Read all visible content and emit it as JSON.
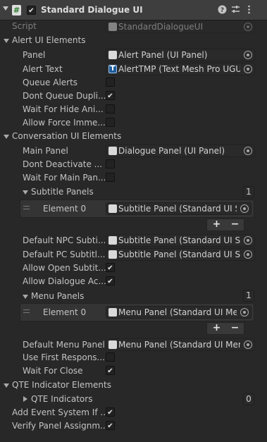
{
  "component": {
    "title": "Standard Dialogue UI",
    "script_label": "Script",
    "script_value": "StandardDialogueUI"
  },
  "alert": {
    "header": "Alert UI Elements",
    "panel_label": "Panel",
    "panel_value": "Alert Panel (UI Panel)",
    "alert_text_label": "Alert Text",
    "alert_text_value": "AlertTMP (Text Mesh Pro UGUI)",
    "queue_alerts_label": "Queue Alerts",
    "dont_queue_label": "Dont Queue Dupli...",
    "wait_hide_label": "Wait For Hide Ani...",
    "allow_force_label": "Allow Force Imme..."
  },
  "conversation": {
    "header": "Conversation UI Elements",
    "main_panel_label": "Main Panel",
    "main_panel_value": "Dialogue Panel (UI Panel)",
    "dont_deactivate_label": "Dont Deactivate ...",
    "wait_main_label": "Wait For Main Pan...",
    "subtitle_panels_label": "Subtitle Panels",
    "subtitle_panels_count": "1",
    "subtitle_element_label": "Element 0",
    "subtitle_element_value": "Subtitle Panel (Standard UI Subtitle Panel)",
    "default_npc_label": "Default NPC Subti...",
    "default_npc_value": "Subtitle Panel (Standard UI Subtitle Panel)",
    "default_pc_label": "Default PC Subtitl...",
    "default_pc_value": "Subtitle Panel (Standard UI Subtitle Panel)",
    "allow_open_label": "Allow Open Subtit...",
    "allow_dialogue_label": "Allow Dialogue Ac...",
    "menu_panels_label": "Menu Panels",
    "menu_panels_count": "1",
    "menu_element_label": "Element 0",
    "menu_element_value": "Menu Panel (Standard UI Menu Panel)",
    "default_menu_label": "Default Menu Panel",
    "default_menu_value": "Menu Panel (Standard UI Menu Panel)",
    "use_first_label": "Use First Respons...",
    "wait_close_label": "Wait For Close"
  },
  "qte": {
    "header": "QTE Indicator Elements",
    "indicators_label": "QTE Indicators",
    "indicators_count": "0"
  },
  "footer": {
    "add_event_label": "Add Event System If ...",
    "verify_label": "Verify Panel Assignm..."
  },
  "buttons": {
    "plus": "+",
    "minus": "−"
  }
}
